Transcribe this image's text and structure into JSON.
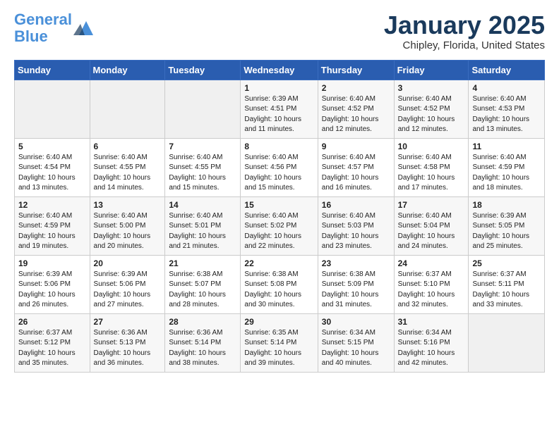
{
  "header": {
    "logo_line1": "General",
    "logo_line2": "Blue",
    "title": "January 2025",
    "subtitle": "Chipley, Florida, United States"
  },
  "days_of_week": [
    "Sunday",
    "Monday",
    "Tuesday",
    "Wednesday",
    "Thursday",
    "Friday",
    "Saturday"
  ],
  "weeks": [
    [
      {
        "day": "",
        "info": ""
      },
      {
        "day": "",
        "info": ""
      },
      {
        "day": "",
        "info": ""
      },
      {
        "day": "1",
        "info": "Sunrise: 6:39 AM\nSunset: 4:51 PM\nDaylight: 10 hours\nand 11 minutes."
      },
      {
        "day": "2",
        "info": "Sunrise: 6:40 AM\nSunset: 4:52 PM\nDaylight: 10 hours\nand 12 minutes."
      },
      {
        "day": "3",
        "info": "Sunrise: 6:40 AM\nSunset: 4:52 PM\nDaylight: 10 hours\nand 12 minutes."
      },
      {
        "day": "4",
        "info": "Sunrise: 6:40 AM\nSunset: 4:53 PM\nDaylight: 10 hours\nand 13 minutes."
      }
    ],
    [
      {
        "day": "5",
        "info": "Sunrise: 6:40 AM\nSunset: 4:54 PM\nDaylight: 10 hours\nand 13 minutes."
      },
      {
        "day": "6",
        "info": "Sunrise: 6:40 AM\nSunset: 4:55 PM\nDaylight: 10 hours\nand 14 minutes."
      },
      {
        "day": "7",
        "info": "Sunrise: 6:40 AM\nSunset: 4:55 PM\nDaylight: 10 hours\nand 15 minutes."
      },
      {
        "day": "8",
        "info": "Sunrise: 6:40 AM\nSunset: 4:56 PM\nDaylight: 10 hours\nand 15 minutes."
      },
      {
        "day": "9",
        "info": "Sunrise: 6:40 AM\nSunset: 4:57 PM\nDaylight: 10 hours\nand 16 minutes."
      },
      {
        "day": "10",
        "info": "Sunrise: 6:40 AM\nSunset: 4:58 PM\nDaylight: 10 hours\nand 17 minutes."
      },
      {
        "day": "11",
        "info": "Sunrise: 6:40 AM\nSunset: 4:59 PM\nDaylight: 10 hours\nand 18 minutes."
      }
    ],
    [
      {
        "day": "12",
        "info": "Sunrise: 6:40 AM\nSunset: 4:59 PM\nDaylight: 10 hours\nand 19 minutes."
      },
      {
        "day": "13",
        "info": "Sunrise: 6:40 AM\nSunset: 5:00 PM\nDaylight: 10 hours\nand 20 minutes."
      },
      {
        "day": "14",
        "info": "Sunrise: 6:40 AM\nSunset: 5:01 PM\nDaylight: 10 hours\nand 21 minutes."
      },
      {
        "day": "15",
        "info": "Sunrise: 6:40 AM\nSunset: 5:02 PM\nDaylight: 10 hours\nand 22 minutes."
      },
      {
        "day": "16",
        "info": "Sunrise: 6:40 AM\nSunset: 5:03 PM\nDaylight: 10 hours\nand 23 minutes."
      },
      {
        "day": "17",
        "info": "Sunrise: 6:40 AM\nSunset: 5:04 PM\nDaylight: 10 hours\nand 24 minutes."
      },
      {
        "day": "18",
        "info": "Sunrise: 6:39 AM\nSunset: 5:05 PM\nDaylight: 10 hours\nand 25 minutes."
      }
    ],
    [
      {
        "day": "19",
        "info": "Sunrise: 6:39 AM\nSunset: 5:06 PM\nDaylight: 10 hours\nand 26 minutes."
      },
      {
        "day": "20",
        "info": "Sunrise: 6:39 AM\nSunset: 5:06 PM\nDaylight: 10 hours\nand 27 minutes."
      },
      {
        "day": "21",
        "info": "Sunrise: 6:38 AM\nSunset: 5:07 PM\nDaylight: 10 hours\nand 28 minutes."
      },
      {
        "day": "22",
        "info": "Sunrise: 6:38 AM\nSunset: 5:08 PM\nDaylight: 10 hours\nand 30 minutes."
      },
      {
        "day": "23",
        "info": "Sunrise: 6:38 AM\nSunset: 5:09 PM\nDaylight: 10 hours\nand 31 minutes."
      },
      {
        "day": "24",
        "info": "Sunrise: 6:37 AM\nSunset: 5:10 PM\nDaylight: 10 hours\nand 32 minutes."
      },
      {
        "day": "25",
        "info": "Sunrise: 6:37 AM\nSunset: 5:11 PM\nDaylight: 10 hours\nand 33 minutes."
      }
    ],
    [
      {
        "day": "26",
        "info": "Sunrise: 6:37 AM\nSunset: 5:12 PM\nDaylight: 10 hours\nand 35 minutes."
      },
      {
        "day": "27",
        "info": "Sunrise: 6:36 AM\nSunset: 5:13 PM\nDaylight: 10 hours\nand 36 minutes."
      },
      {
        "day": "28",
        "info": "Sunrise: 6:36 AM\nSunset: 5:14 PM\nDaylight: 10 hours\nand 38 minutes."
      },
      {
        "day": "29",
        "info": "Sunrise: 6:35 AM\nSunset: 5:14 PM\nDaylight: 10 hours\nand 39 minutes."
      },
      {
        "day": "30",
        "info": "Sunrise: 6:34 AM\nSunset: 5:15 PM\nDaylight: 10 hours\nand 40 minutes."
      },
      {
        "day": "31",
        "info": "Sunrise: 6:34 AM\nSunset: 5:16 PM\nDaylight: 10 hours\nand 42 minutes."
      },
      {
        "day": "",
        "info": ""
      }
    ]
  ]
}
